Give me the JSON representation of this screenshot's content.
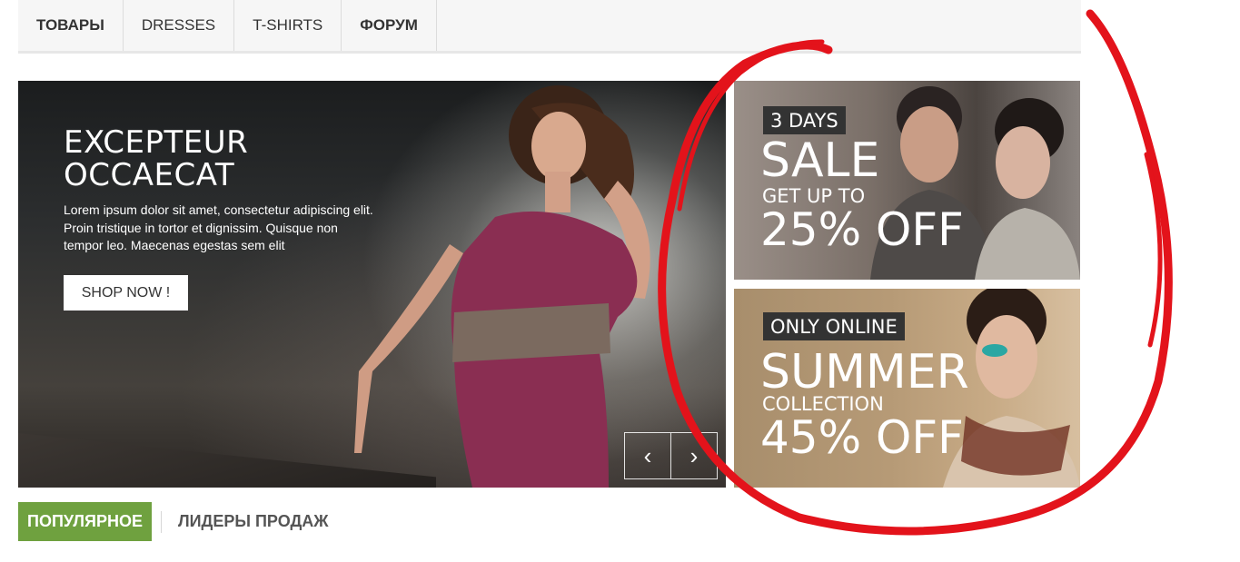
{
  "nav": {
    "items": [
      {
        "label": "ТОВАРЫ",
        "bold": true
      },
      {
        "label": "DRESSES",
        "bold": false
      },
      {
        "label": "T-SHIRTS",
        "bold": false
      },
      {
        "label": "ФОРУМ",
        "bold": true
      }
    ]
  },
  "slider": {
    "title_line1": "EXCEPTEUR",
    "title_line2": "OCCAECAT",
    "text": "Lorem ipsum dolor sit amet, consectetur adipiscing elit. Proin tristique in tortor et dignissim. Quisque non tempor leo. Maecenas egestas sem elit",
    "button": "SHOP NOW !",
    "prev_icon": "‹",
    "next_icon": "›"
  },
  "banners": [
    {
      "tag": "3 DAYS",
      "big": "SALE",
      "small": "GET UP TO",
      "off": "25% OFF"
    },
    {
      "tag": "ONLY ONLINE",
      "big": "SUMMER",
      "small": "COLLECTION",
      "off": "45% OFF"
    }
  ],
  "tabs": {
    "active": "ПОПУЛЯРНОЕ",
    "inactive": "ЛИДЕРЫ ПРОДАЖ"
  },
  "colors": {
    "accent_green": "#6fa13f",
    "annotation_red": "#e3131b"
  }
}
